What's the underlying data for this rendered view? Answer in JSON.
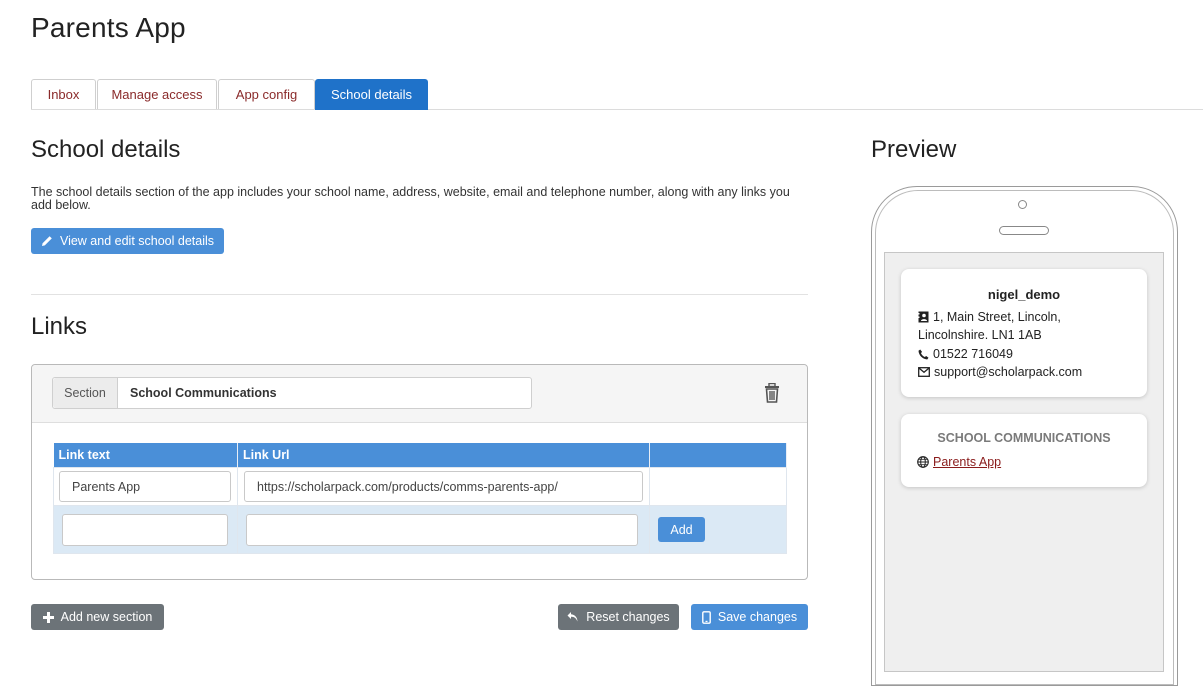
{
  "app": {
    "title": "Parents App"
  },
  "tabs": [
    {
      "label": "Inbox",
      "active": false
    },
    {
      "label": "Manage access",
      "active": false
    },
    {
      "label": "App config",
      "active": false
    },
    {
      "label": "School details",
      "active": true
    }
  ],
  "school_details": {
    "heading": "School details",
    "description": "The school details section of the app includes your school name, address, website, email and telephone number, along with any links you add below.",
    "edit_button": "View and edit school details"
  },
  "links": {
    "heading": "Links",
    "section_addon": "Section",
    "section_name": "School Communications",
    "columns": [
      "Link text",
      "Link Url",
      ""
    ],
    "rows": [
      {
        "text": "Parents App",
        "url": "https://scholarpack.com/products/comms-parents-app/"
      }
    ],
    "new_row": {
      "text": "",
      "url": "",
      "add_label": "Add"
    }
  },
  "footer": {
    "add_section": "Add new section",
    "reset": "Reset changes",
    "save": "Save changes"
  },
  "preview": {
    "heading": "Preview",
    "school_name": "nigel_demo",
    "address_line1": "1, Main Street, Lincoln,",
    "address_line2": "Lincolnshire. LN1 1AB",
    "phone": "01522 716049",
    "email": "support@scholarpack.com",
    "section_title": "SCHOOL COMMUNICATIONS",
    "link_label": "Parents App"
  },
  "colors": {
    "accent": "#4a8fd8",
    "tab_active": "#1f72c9",
    "secondary": "#6c7378",
    "link": "#8a1c1c"
  }
}
